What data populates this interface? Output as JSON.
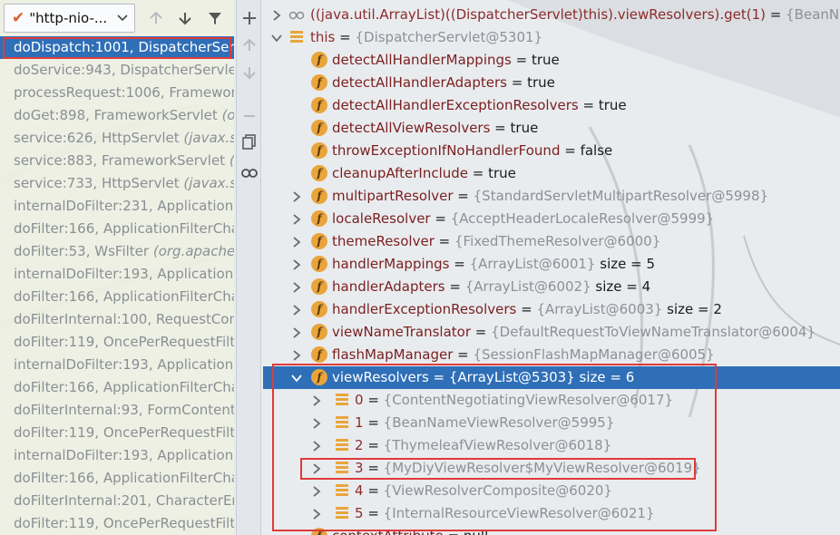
{
  "thread_selector": {
    "label": "\"http-nio-..."
  },
  "frames": [
    {
      "method": "doDispatch:1001,",
      "cls": "DispatcherServ",
      "pkg": "",
      "selected": true
    },
    {
      "method": "doService:943,",
      "cls": "DispatcherServlet",
      "pkg": "",
      "selected": false
    },
    {
      "method": "processRequest:1006,",
      "cls": "Framework",
      "pkg": "",
      "selected": false
    },
    {
      "method": "doGet:898,",
      "cls": "FrameworkServlet",
      "pkg": "(or",
      "selected": false
    },
    {
      "method": "service:626,",
      "cls": "HttpServlet",
      "pkg": "(javax.serv",
      "selected": false
    },
    {
      "method": "service:883,",
      "cls": "FrameworkServlet",
      "pkg": "(o",
      "selected": false
    },
    {
      "method": "service:733,",
      "cls": "HttpServlet",
      "pkg": "(javax.se",
      "selected": false
    },
    {
      "method": "internalDoFilter:231,",
      "cls": "ApplicationF",
      "pkg": "",
      "selected": false
    },
    {
      "method": "doFilter:166,",
      "cls": "ApplicationFilterCha",
      "pkg": "",
      "selected": false
    },
    {
      "method": "doFilter:53,",
      "cls": "WsFilter",
      "pkg": "(org.apache.",
      "selected": false
    },
    {
      "method": "internalDoFilter:193,",
      "cls": "ApplicationF",
      "pkg": "",
      "selected": false
    },
    {
      "method": "doFilter:166,",
      "cls": "ApplicationFilterCha",
      "pkg": "",
      "selected": false
    },
    {
      "method": "doFilterInternal:100,",
      "cls": "RequestCont",
      "pkg": "",
      "selected": false
    },
    {
      "method": "doFilter:119,",
      "cls": "OncePerRequestFilte",
      "pkg": "",
      "selected": false
    },
    {
      "method": "internalDoFilter:193,",
      "cls": "ApplicationF",
      "pkg": "",
      "selected": false
    },
    {
      "method": "doFilter:166,",
      "cls": "ApplicationFilterCha",
      "pkg": "",
      "selected": false
    },
    {
      "method": "doFilterInternal:93,",
      "cls": "FormContentF",
      "pkg": "",
      "selected": false
    },
    {
      "method": "doFilter:119,",
      "cls": "OncePerRequestFilte",
      "pkg": "",
      "selected": false
    },
    {
      "method": "internalDoFilter:193,",
      "cls": "ApplicationF",
      "pkg": "",
      "selected": false
    },
    {
      "method": "doFilter:166,",
      "cls": "ApplicationFilterCha",
      "pkg": "",
      "selected": false
    },
    {
      "method": "doFilterInternal:201,",
      "cls": "CharacterEnc",
      "pkg": "",
      "selected": false
    },
    {
      "method": "doFilter:119,",
      "cls": "OncePerRequestFilte",
      "pkg": "",
      "selected": false
    }
  ],
  "variables": [
    {
      "depth": 0,
      "arrow": "right",
      "icon": "watch",
      "name": "((java.util.ArrayList)((DispatcherServlet)this).viewResolvers).get(1)",
      "value": "{BeanNameV",
      "size": "",
      "prim": false
    },
    {
      "depth": 0,
      "arrow": "down",
      "icon": "param",
      "name": "this",
      "value": "{DispatcherServlet@5301}",
      "size": "",
      "prim": false
    },
    {
      "depth": 1,
      "arrow": "",
      "icon": "field",
      "name": "detectAllHandlerMappings",
      "value": "true",
      "size": "",
      "prim": true
    },
    {
      "depth": 1,
      "arrow": "",
      "icon": "field",
      "name": "detectAllHandlerAdapters",
      "value": "true",
      "size": "",
      "prim": true
    },
    {
      "depth": 1,
      "arrow": "",
      "icon": "field",
      "name": "detectAllHandlerExceptionResolvers",
      "value": "true",
      "size": "",
      "prim": true
    },
    {
      "depth": 1,
      "arrow": "",
      "icon": "field",
      "name": "detectAllViewResolvers",
      "value": "true",
      "size": "",
      "prim": true
    },
    {
      "depth": 1,
      "arrow": "",
      "icon": "field",
      "name": "throwExceptionIfNoHandlerFound",
      "value": "false",
      "size": "",
      "prim": true
    },
    {
      "depth": 1,
      "arrow": "",
      "icon": "field",
      "name": "cleanupAfterInclude",
      "value": "true",
      "size": "",
      "prim": true
    },
    {
      "depth": 1,
      "arrow": "right",
      "icon": "field",
      "name": "multipartResolver",
      "value": "{StandardServletMultipartResolver@5998}",
      "size": "",
      "prim": false
    },
    {
      "depth": 1,
      "arrow": "right",
      "icon": "field",
      "name": "localeResolver",
      "value": "{AcceptHeaderLocaleResolver@5999}",
      "size": "",
      "prim": false
    },
    {
      "depth": 1,
      "arrow": "right",
      "icon": "field",
      "name": "themeResolver",
      "value": "{FixedThemeResolver@6000}",
      "size": "",
      "prim": false
    },
    {
      "depth": 1,
      "arrow": "right",
      "icon": "field",
      "name": "handlerMappings",
      "value": "{ArrayList@6001}",
      "size": "size = 5",
      "prim": false
    },
    {
      "depth": 1,
      "arrow": "right",
      "icon": "field",
      "name": "handlerAdapters",
      "value": "{ArrayList@6002}",
      "size": "size = 4",
      "prim": false
    },
    {
      "depth": 1,
      "arrow": "right",
      "icon": "field",
      "name": "handlerExceptionResolvers",
      "value": "{ArrayList@6003}",
      "size": "size = 2",
      "prim": false
    },
    {
      "depth": 1,
      "arrow": "right",
      "icon": "field",
      "name": "viewNameTranslator",
      "value": "{DefaultRequestToViewNameTranslator@6004}",
      "size": "",
      "prim": false
    },
    {
      "depth": 1,
      "arrow": "right",
      "icon": "field",
      "name": "flashMapManager",
      "value": "{SessionFlashMapManager@6005}",
      "size": "",
      "prim": false
    },
    {
      "depth": 1,
      "arrow": "down",
      "icon": "field",
      "name": "viewResolvers",
      "value": "{ArrayList@5303}",
      "size": "size = 6",
      "prim": false,
      "selected": true
    },
    {
      "depth": 2,
      "arrow": "right",
      "icon": "array",
      "name": "0",
      "value": "{ContentNegotiatingViewResolver@6017}",
      "size": "",
      "prim": false
    },
    {
      "depth": 2,
      "arrow": "right",
      "icon": "array",
      "name": "1",
      "value": "{BeanNameViewResolver@5995}",
      "size": "",
      "prim": false
    },
    {
      "depth": 2,
      "arrow": "right",
      "icon": "array",
      "name": "2",
      "value": "{ThymeleafViewResolver@6018}",
      "size": "",
      "prim": false
    },
    {
      "depth": 2,
      "arrow": "right",
      "icon": "array",
      "name": "3",
      "value": "{MyDiyViewResolver$MyViewResolver@6019}",
      "size": "",
      "prim": false
    },
    {
      "depth": 2,
      "arrow": "right",
      "icon": "array",
      "name": "4",
      "value": "{ViewResolverComposite@6020}",
      "size": "",
      "prim": false
    },
    {
      "depth": 2,
      "arrow": "right",
      "icon": "array",
      "name": "5",
      "value": "{InternalResourceViewResolver@6021}",
      "size": "",
      "prim": false
    },
    {
      "depth": 1,
      "arrow": "",
      "icon": "field",
      "name": "contextAttribute",
      "value": "null",
      "size": "",
      "prim": true
    }
  ],
  "colors": {
    "selection": "#2f6fb7",
    "field_icon": "#e9a53c",
    "highlight_box": "#e03a3a",
    "variable_name": "#8b2b2b",
    "value_gray": "#8c9196"
  }
}
